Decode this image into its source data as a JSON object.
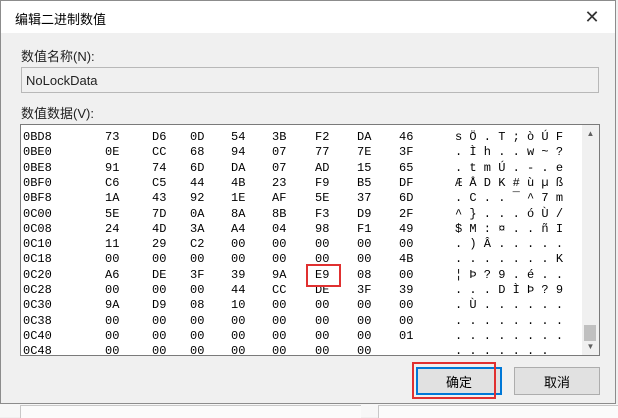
{
  "window": {
    "title": "编辑二进制数值",
    "close_glyph": "✕"
  },
  "value_name": {
    "label": "数值名称(N):",
    "value": "NoLockData"
  },
  "value_data": {
    "label": "数值数据(V):"
  },
  "hex_rows": [
    {
      "offset": "0BD8",
      "bytes": [
        "73",
        "D6",
        "0D",
        "54",
        "3B",
        "F2",
        "DA",
        "46"
      ],
      "ascii": "s Ö . T ; ò Ú F"
    },
    {
      "offset": "0BE0",
      "bytes": [
        "0E",
        "CC",
        "68",
        "94",
        "07",
        "77",
        "7E",
        "3F"
      ],
      "ascii": ". Ì h . . w ~ ?"
    },
    {
      "offset": "0BE8",
      "bytes": [
        "91",
        "74",
        "6D",
        "DA",
        "07",
        "AD",
        "15",
        "65"
      ],
      "ascii": ". t m Ú . - . e"
    },
    {
      "offset": "0BF0",
      "bytes": [
        "C6",
        "C5",
        "44",
        "4B",
        "23",
        "F9",
        "B5",
        "DF"
      ],
      "ascii": "Æ Å D K # ù µ ß"
    },
    {
      "offset": "0BF8",
      "bytes": [
        "1A",
        "43",
        "92",
        "1E",
        "AF",
        "5E",
        "37",
        "6D"
      ],
      "ascii": ". C . . ¯ ^ 7 m"
    },
    {
      "offset": "0C00",
      "bytes": [
        "5E",
        "7D",
        "0A",
        "8A",
        "8B",
        "F3",
        "D9",
        "2F"
      ],
      "ascii": "^ } . . . ó Ù /"
    },
    {
      "offset": "0C08",
      "bytes": [
        "24",
        "4D",
        "3A",
        "A4",
        "04",
        "98",
        "F1",
        "49"
      ],
      "ascii": "$ M : ¤ . . ñ I"
    },
    {
      "offset": "0C10",
      "bytes": [
        "11",
        "29",
        "C2",
        "00",
        "00",
        "00",
        "00",
        "00"
      ],
      "ascii": ". ) Â . . . . ."
    },
    {
      "offset": "0C18",
      "bytes": [
        "00",
        "00",
        "00",
        "00",
        "00",
        "00",
        "00",
        "4B"
      ],
      "ascii": ". . . . . . . K"
    },
    {
      "offset": "0C20",
      "bytes": [
        "A6",
        "DE",
        "3F",
        "39",
        "9A",
        "E9",
        "08",
        "00"
      ],
      "ascii": "¦ Þ ? 9 . é . ."
    },
    {
      "offset": "0C28",
      "bytes": [
        "00",
        "00",
        "00",
        "44",
        "CC",
        "DE",
        "3F",
        "39"
      ],
      "ascii": ". . . D Ì Þ ? 9"
    },
    {
      "offset": "0C30",
      "bytes": [
        "9A",
        "D9",
        "08",
        "10",
        "00",
        "00",
        "00",
        "00"
      ],
      "ascii": ". Ù . . . . . ."
    },
    {
      "offset": "0C38",
      "bytes": [
        "00",
        "00",
        "00",
        "00",
        "00",
        "00",
        "00",
        "00"
      ],
      "ascii": ". . . . . . . ."
    },
    {
      "offset": "0C40",
      "bytes": [
        "00",
        "00",
        "00",
        "00",
        "00",
        "00",
        "00",
        "01"
      ],
      "ascii": ". . . . . . . ."
    },
    {
      "offset": "0C48",
      "bytes": [
        "00",
        "00",
        "00",
        "00",
        "00",
        "00",
        "00",
        ""
      ],
      "ascii": ". . . . . . ."
    }
  ],
  "highlight": {
    "row": 9,
    "col": 5,
    "color": "#e03030"
  },
  "buttons": {
    "ok": "确定",
    "cancel": "取消"
  },
  "colors": {
    "highlight_frame": "#e03030",
    "default_button_border": "#0078d7"
  },
  "icons": {
    "close": "close-icon",
    "scroll_up": "chevron-up-icon",
    "scroll_down": "chevron-down-icon"
  }
}
